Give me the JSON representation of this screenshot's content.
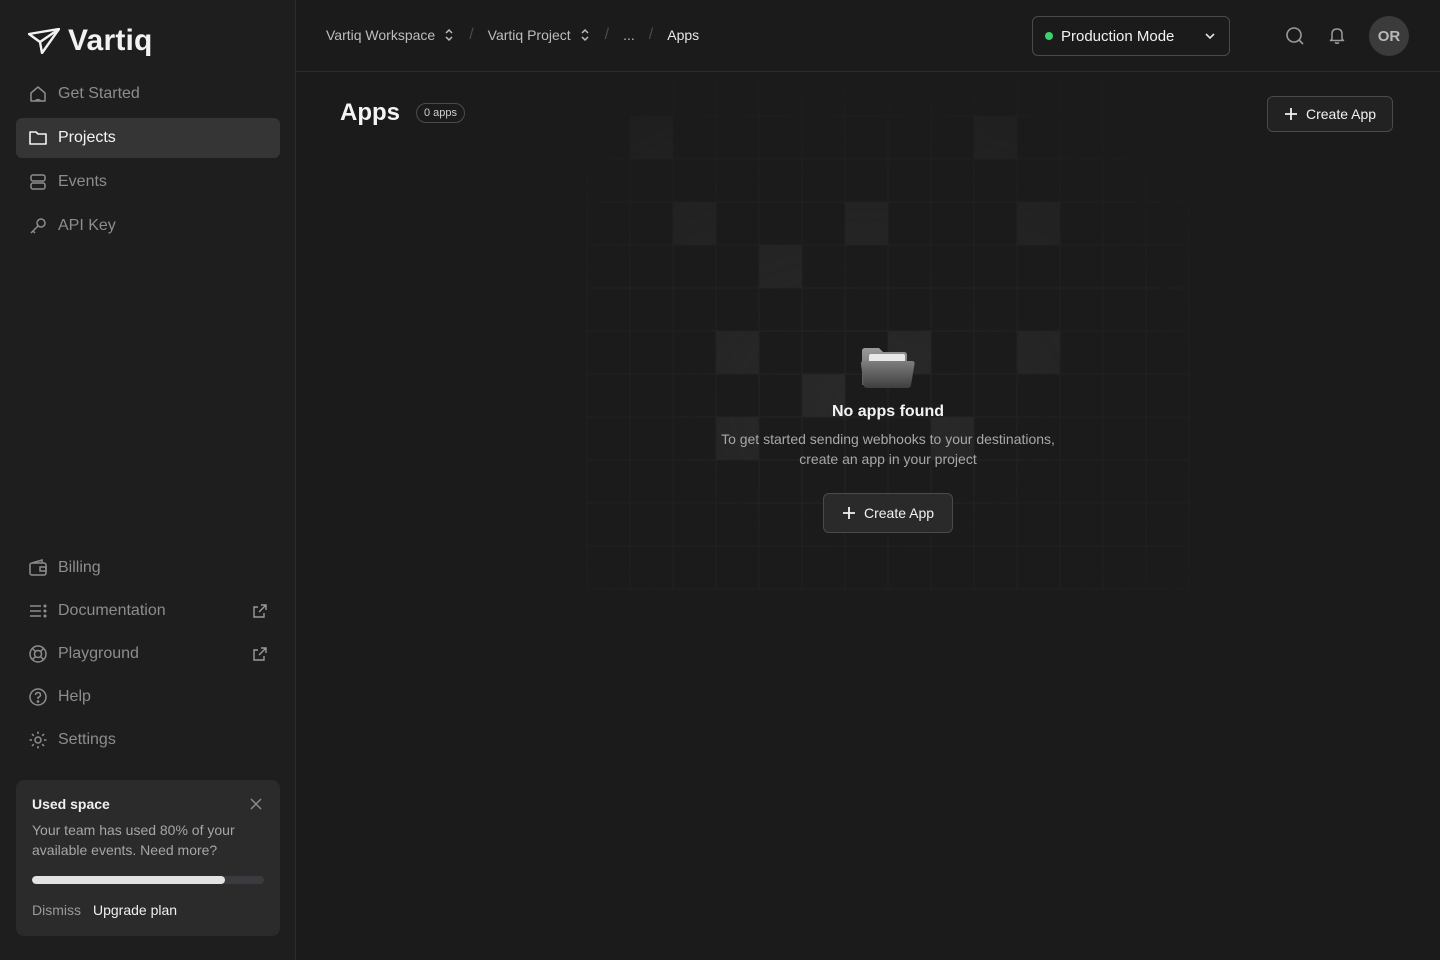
{
  "brand": {
    "name": "Vartiq"
  },
  "sidebar": {
    "nav": [
      {
        "label": "Get Started",
        "icon": "home-icon"
      },
      {
        "label": "Projects",
        "icon": "folder-icon",
        "active": true
      },
      {
        "label": "Events",
        "icon": "stack-icon"
      },
      {
        "label": "API Key",
        "icon": "key-icon"
      }
    ],
    "bottom_nav": [
      {
        "label": "Billing",
        "icon": "wallet-icon"
      },
      {
        "label": "Documentation",
        "icon": "list-icon",
        "external": true
      },
      {
        "label": "Playground",
        "icon": "lifebuoy-icon",
        "external": true
      },
      {
        "label": "Help",
        "icon": "help-icon"
      },
      {
        "label": "Settings",
        "icon": "gear-icon"
      }
    ],
    "usage": {
      "title": "Used space",
      "description": "Your team has used 80% of your available events. Need more?",
      "progress_fraction": 0.83,
      "dismiss_label": "Dismiss",
      "upgrade_label": "Upgrade plan"
    }
  },
  "topbar": {
    "breadcrumb": {
      "workspace": "Vartiq Workspace",
      "project": "Vartiq Project",
      "ellipsis": "...",
      "current": "Apps",
      "separator": "/"
    },
    "mode": {
      "label": "Production Mode",
      "status_color": "#3ecf6e"
    },
    "avatar_initials": "OR"
  },
  "main": {
    "title": "Apps",
    "count_label": "0 apps",
    "create_button": "Create App",
    "empty": {
      "title": "No apps found",
      "line1": "To get started sending webhooks to your destinations,",
      "line2": "create an app in your project",
      "button": "Create App"
    }
  },
  "colors": {
    "background": "#1b1b1b",
    "sidebar": "#1e1e1e",
    "active_item": "#353535",
    "status_green": "#3ecf6e"
  }
}
